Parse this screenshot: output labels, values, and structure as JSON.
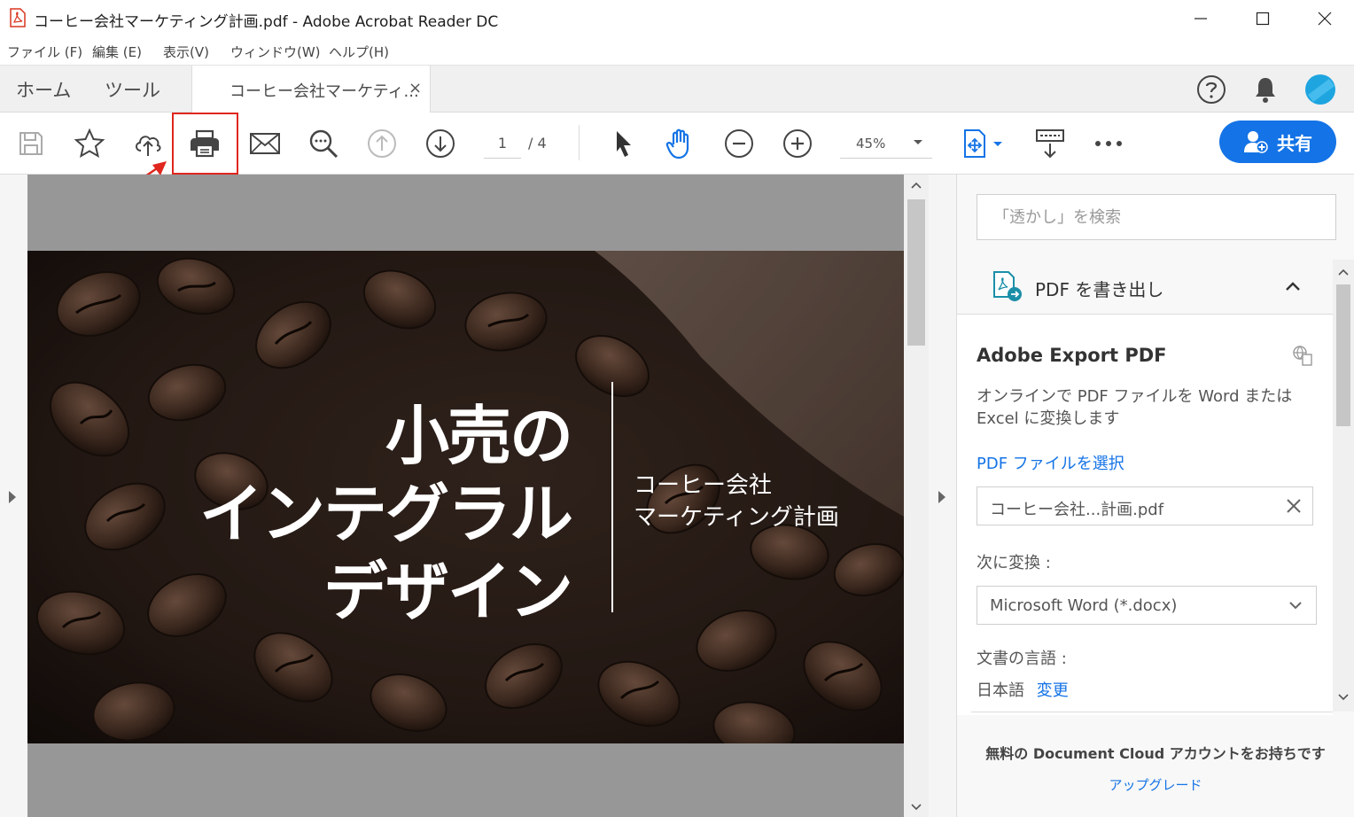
{
  "window": {
    "title": "コーヒー会社マーケティング計画.pdf - Adobe Acrobat Reader DC"
  },
  "menu": {
    "items": [
      {
        "label": "ファイル (F)"
      },
      {
        "label": "編集 (E)"
      },
      {
        "label": "表示(V)"
      },
      {
        "label": "ウィンドウ(W)"
      },
      {
        "label": "ヘルプ(H)"
      }
    ]
  },
  "tabs": {
    "home": "ホーム",
    "tools": "ツール",
    "document": "コーヒー会社マーケティ...",
    "close": "×"
  },
  "toolbar": {
    "current_page": "1",
    "total_pages": "/ 4",
    "zoom": "45%",
    "share_label": "共有"
  },
  "document": {
    "title_lines": [
      "小売の",
      "インテグラル",
      "デザイン"
    ],
    "subtitle_lines": [
      "コーヒー会社",
      "マーケティング計画"
    ]
  },
  "panel": {
    "search_placeholder": "「透かし」を検索",
    "export_header": "PDF を書き出し",
    "card_title": "Adobe Export PDF",
    "card_desc": "オンラインで PDF ファイルを Word または Excel に変換します",
    "select_file_link": "PDF ファイルを選択",
    "file_name": "コーヒー会社...計画.pdf",
    "convert_label": "次に変換 :",
    "convert_value": "Microsoft Word (*.docx)",
    "language_label": "文書の言語 :",
    "language_value": "日本語",
    "language_change": "変更",
    "promo_text": "無料の Document Cloud アカウントをお持ちです",
    "upgrade_link": "アップグレード"
  },
  "colors": {
    "accent": "#1473e6",
    "highlight": "#e0261d"
  }
}
